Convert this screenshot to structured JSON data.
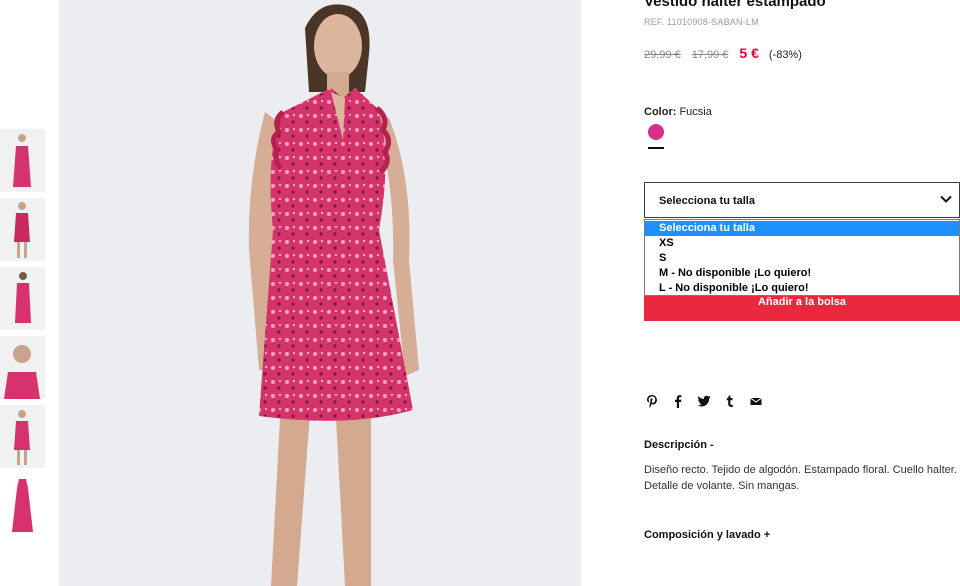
{
  "product": {
    "title": "Vestido halter estampado",
    "ref": "REF. 11010908-SABAN-LM",
    "price_original": "29,99 €",
    "price_previous": "17,99 €",
    "price_current": "5 €",
    "discount": "(-83%)"
  },
  "color": {
    "label": "Color:",
    "value": "Fucsia",
    "swatch_color": "#d6318a"
  },
  "size_select": {
    "selected": "Selecciona tu talla",
    "options": [
      "Selecciona tu talla",
      "XS",
      "S",
      "M - No disponible ¡Lo quiero!",
      "L - No disponible ¡Lo quiero!"
    ]
  },
  "add_to_bag": "Añadir a la bolsa",
  "share_icons": [
    "pinterest-icon",
    "facebook-icon",
    "twitter-icon",
    "tumblr-icon",
    "mail-icon"
  ],
  "description": {
    "title": "Descripción -",
    "text": "Diseño recto. Tejido de algodón. Estampado floral. Cuello halter. Detalle de volante. Sin mangas."
  },
  "composition": {
    "title": "Composición y lavado +"
  },
  "colors": {
    "accent_red": "#e8283c",
    "price_red": "#e4002b",
    "dress_pink": "#d6336e",
    "selected_option_blue": "#1e90ff"
  }
}
